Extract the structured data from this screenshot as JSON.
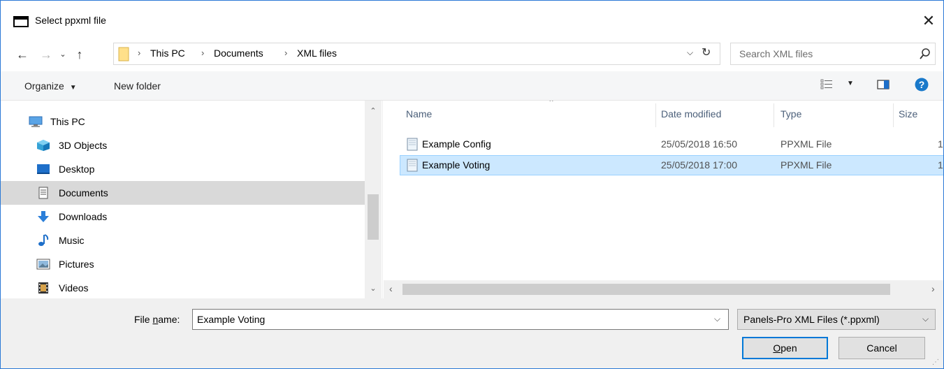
{
  "window": {
    "title": "Select ppxml file"
  },
  "address_bar": {
    "breadcrumbs": [
      "This PC",
      "Documents",
      "XML files"
    ],
    "search_placeholder": "Search XML files"
  },
  "toolbar": {
    "organize_label": "Organize",
    "new_folder_label": "New folder"
  },
  "nav_pane": {
    "items": [
      {
        "label": "This PC",
        "icon": "computer-icon"
      },
      {
        "label": "3D Objects",
        "icon": "3d-objects-icon"
      },
      {
        "label": "Desktop",
        "icon": "desktop-icon"
      },
      {
        "label": "Documents",
        "icon": "documents-icon",
        "selected": true
      },
      {
        "label": "Downloads",
        "icon": "downloads-icon"
      },
      {
        "label": "Music",
        "icon": "music-icon"
      },
      {
        "label": "Pictures",
        "icon": "pictures-icon"
      },
      {
        "label": "Videos",
        "icon": "videos-icon"
      }
    ]
  },
  "file_list": {
    "columns": [
      "Name",
      "Date modified",
      "Type",
      "Size"
    ],
    "rows": [
      {
        "name": "Example Config",
        "date": "25/05/2018 16:50",
        "type": "PPXML File",
        "size": "1",
        "selected": false
      },
      {
        "name": "Example Voting",
        "date": "25/05/2018 17:00",
        "type": "PPXML File",
        "size": "1",
        "selected": true
      }
    ]
  },
  "bottom": {
    "file_name_label_prefix": "File ",
    "file_name_label_underlined": "n",
    "file_name_label_suffix": "ame:",
    "file_name_value": "Example Voting",
    "file_type_filter": "Panels-Pro XML Files (*.ppxml)",
    "open_label_underlined": "O",
    "open_label_rest": "pen",
    "cancel_label": "Cancel"
  },
  "colors": {
    "accent": "#0078d7",
    "selected_row_bg": "#cce8ff",
    "selected_nav_bg": "#d9d9d9",
    "help_icon": "#1979ca"
  }
}
